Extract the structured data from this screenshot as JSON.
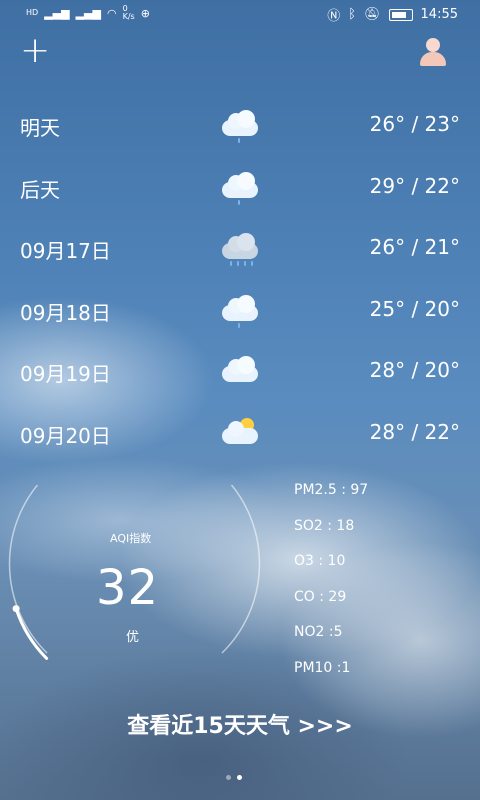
{
  "status_bar": {
    "net_speed_value": "0",
    "net_speed_unit": "K/s",
    "time": "14:55",
    "hd_label": "HD"
  },
  "forecast": [
    {
      "day": "明天",
      "temp": "26° / 23°",
      "icon": "rain-cloud-icon"
    },
    {
      "day": "后天",
      "temp": "29° / 22°",
      "icon": "rain-cloud-icon"
    },
    {
      "day": "09月17日",
      "temp": "26° / 21°",
      "icon": "heavy-rain-cloud-icon"
    },
    {
      "day": "09月18日",
      "temp": "25° / 20°",
      "icon": "rain-cloud-icon"
    },
    {
      "day": "09月19日",
      "temp": "28° / 20°",
      "icon": "cloud-icon"
    },
    {
      "day": "09月20日",
      "temp": "28° / 22°",
      "icon": "partly-sunny-icon"
    }
  ],
  "aqi": {
    "label": "AQI指数",
    "value": "32",
    "level": "优",
    "progress": 0.1
  },
  "pollutants": [
    "PM2.5 : 97",
    "SO2 : 18",
    "O3 : 10",
    "CO :  29",
    "NO2 :5",
    "PM10 :1"
  ],
  "more_button": "查看近15天天气 >>>",
  "pager": {
    "count": 2,
    "active": 1
  }
}
